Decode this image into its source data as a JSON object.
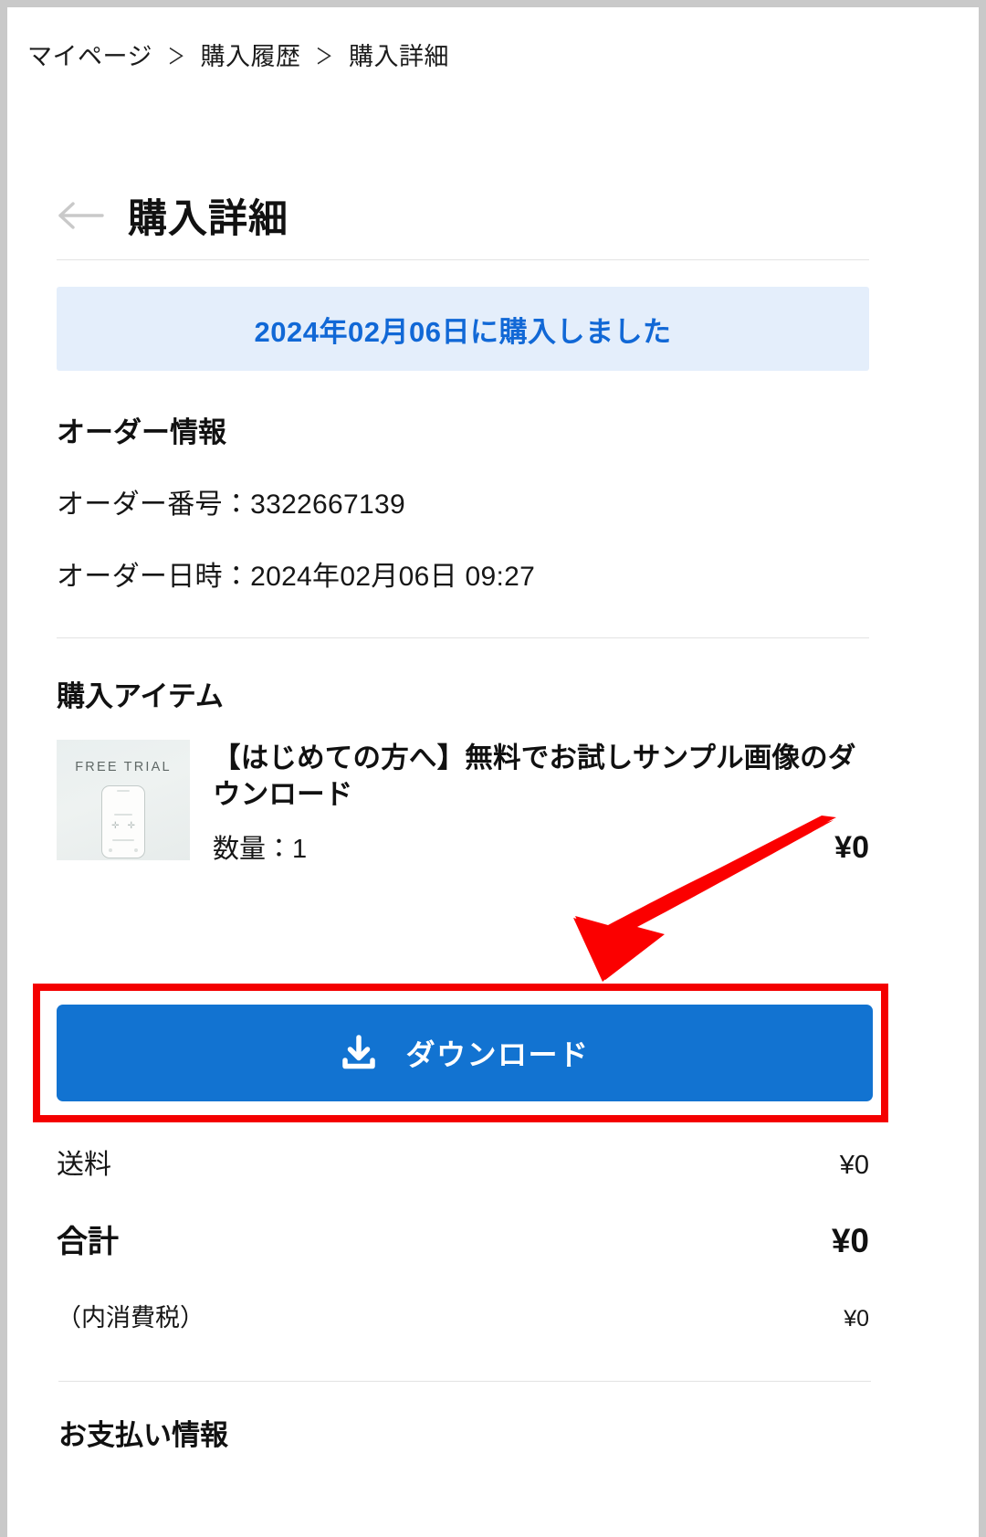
{
  "breadcrumb": {
    "items": [
      {
        "label": "マイページ"
      },
      {
        "label": "購入履歴"
      },
      {
        "label": "購入詳細"
      }
    ],
    "separator": "＞"
  },
  "header": {
    "title": "購入詳細",
    "back_icon": "arrow-left-icon"
  },
  "banner": {
    "text": "2024年02月06日に購入しました",
    "text_color": "#1168d6",
    "background_color": "#e4eefb"
  },
  "order_info": {
    "heading": "オーダー情報",
    "order_number_line": "オーダー番号：3322667139",
    "order_datetime_line": "オーダー日時：2024年02月06日 09:27",
    "order_number": "3322667139",
    "order_datetime": "2024年02月06日 09:27"
  },
  "purchase_item": {
    "heading": "購入アイテム",
    "thumbnail": {
      "label": "FREE TRIAL",
      "icon": "phone-mockup-icon"
    },
    "title": "【はじめての方へ】無料でお試しサンプル画像のダウンロード",
    "quantity_label": "数量：1",
    "price": "¥0"
  },
  "download": {
    "label": "ダウンロード",
    "icon": "download-icon",
    "button_color": "#1273d1",
    "highlight_color": "#f40000"
  },
  "totals": {
    "shipping_label": "送料",
    "shipping_value": "¥0",
    "total_label": "合計",
    "total_value": "¥0",
    "tax_label": "（内消費税）",
    "tax_value": "¥0"
  },
  "payment": {
    "heading": "お支払い情報"
  }
}
